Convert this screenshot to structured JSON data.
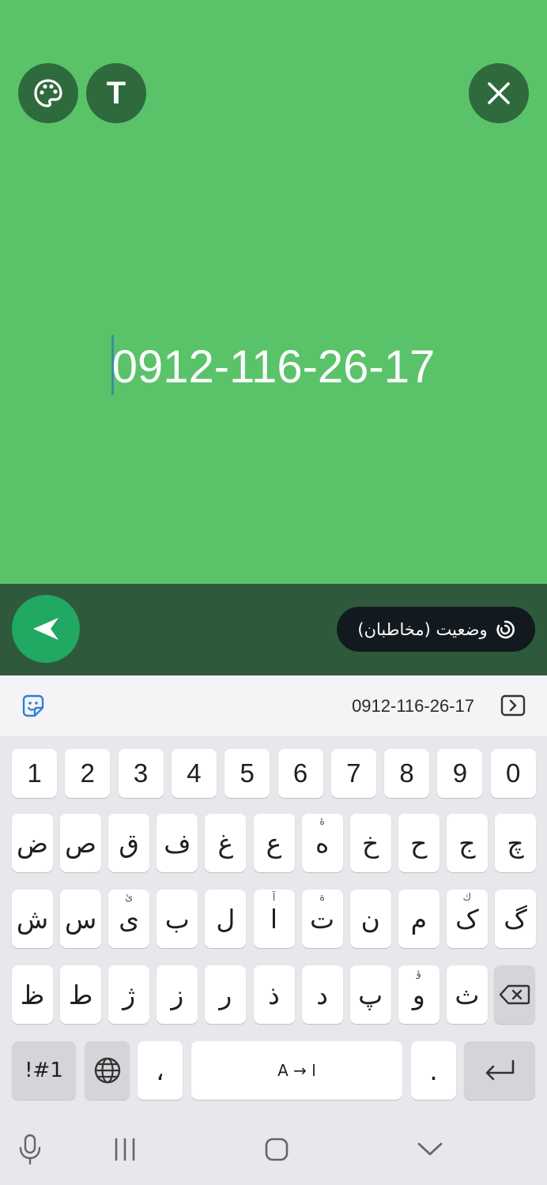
{
  "editor": {
    "status_text": "0912-116-26-17",
    "palette_icon": "palette-icon",
    "text_style_label": "T",
    "close_icon": "close-icon"
  },
  "bottom_bar": {
    "send_icon": "send-arrow-icon",
    "privacy_label": "وضعیت (مخاطبان)",
    "privacy_icon": "privacy-ring-icon"
  },
  "suggestion_bar": {
    "suggestion": "0912-116-26-17",
    "sticker_icon": "sticker-icon",
    "cursor_icon": "cursor-move-icon"
  },
  "keyboard": {
    "numbers": [
      "1",
      "2",
      "3",
      "4",
      "5",
      "6",
      "7",
      "8",
      "9",
      "0"
    ],
    "row1": [
      {
        "label": "ض"
      },
      {
        "label": "ص"
      },
      {
        "label": "ق"
      },
      {
        "label": "ف"
      },
      {
        "label": "غ"
      },
      {
        "label": "ع"
      },
      {
        "label": "ه",
        "hint": "ۀ"
      },
      {
        "label": "خ"
      },
      {
        "label": "ح"
      },
      {
        "label": "ج"
      },
      {
        "label": "چ"
      }
    ],
    "row2": [
      {
        "label": "ش"
      },
      {
        "label": "س"
      },
      {
        "label": "ی",
        "hint": "ئ"
      },
      {
        "label": "ب"
      },
      {
        "label": "ل"
      },
      {
        "label": "ا",
        "hint": "آ"
      },
      {
        "label": "ت",
        "hint": "ة"
      },
      {
        "label": "ن"
      },
      {
        "label": "م"
      },
      {
        "label": "ک",
        "hint": "ك"
      },
      {
        "label": "گ"
      }
    ],
    "row3": [
      {
        "label": "ظ"
      },
      {
        "label": "ط"
      },
      {
        "label": "ژ"
      },
      {
        "label": "ز"
      },
      {
        "label": "ر"
      },
      {
        "label": "ذ"
      },
      {
        "label": "د"
      },
      {
        "label": "پ"
      },
      {
        "label": "و",
        "hint": "ؤ"
      },
      {
        "label": "ث"
      }
    ],
    "symbols_label": "!#1",
    "globe_icon": "globe-icon",
    "comma_label": "،",
    "space_label": "A → ا",
    "period_label": ".",
    "backspace_icon": "backspace-icon",
    "enter_icon": "enter-icon"
  },
  "nav": {
    "mic_icon": "microphone-icon",
    "recents_icon": "recents-icon",
    "home_icon": "home-icon",
    "hide_keyboard_icon": "chevron-down-icon"
  }
}
